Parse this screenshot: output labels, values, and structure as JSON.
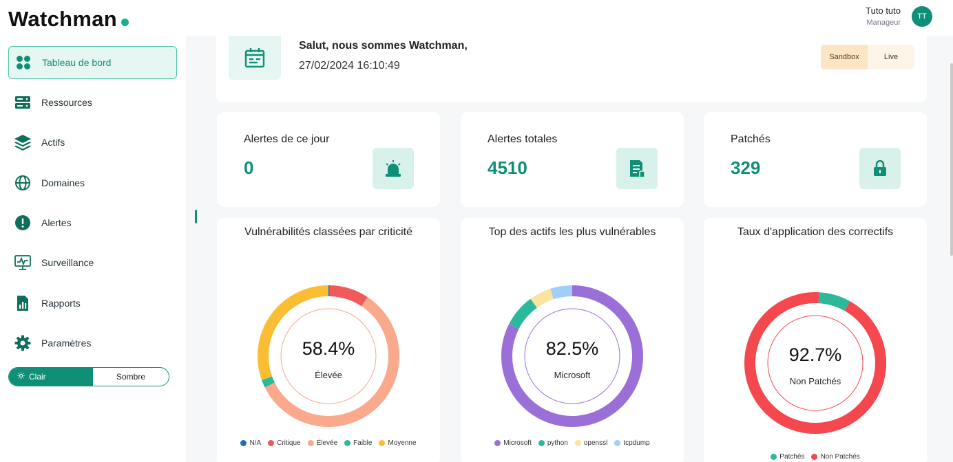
{
  "brand": {
    "name": "Watchman"
  },
  "user": {
    "name": "Tuto tuto",
    "role": "Manageur",
    "initials": "TT"
  },
  "sidebar": {
    "items": [
      {
        "label": "Tableau de bord",
        "icon": "dashboard-icon"
      },
      {
        "label": "Ressources",
        "icon": "server-icon"
      },
      {
        "label": "Actifs",
        "icon": "layers-icon"
      },
      {
        "label": "Domaines",
        "icon": "globe-icon"
      },
      {
        "label": "Alertes",
        "icon": "alert-icon"
      },
      {
        "label": "Surveillance",
        "icon": "monitor-icon"
      },
      {
        "label": "Rapports",
        "icon": "report-icon"
      },
      {
        "label": "Paramètres",
        "icon": "gear-icon"
      }
    ],
    "theme": {
      "light": "Clair",
      "dark": "Sombre",
      "selected": "Clair"
    }
  },
  "welcome": {
    "greeting": "Salut, nous sommes Watchman,",
    "datetime": "27/02/2024 16:10:49",
    "env": {
      "sandbox": "Sandbox",
      "live": "Live",
      "selected": "Sandbox"
    }
  },
  "stats": [
    {
      "title": "Alertes de ce jour",
      "value": "0",
      "icon": "siren-icon"
    },
    {
      "title": "Alertes totales",
      "value": "4510",
      "icon": "document-icon"
    },
    {
      "title": "Patchés",
      "value": "329",
      "icon": "lock-icon"
    }
  ],
  "colors": {
    "accent": "#0e8f76",
    "accentLight": "#e6f6f2"
  },
  "chart_data": [
    {
      "type": "pie",
      "title": "Vulnérabilités classées par criticité",
      "center_value": "58.4%",
      "center_label": "Élevée",
      "categories": [
        "N/A",
        "Critique",
        "Élevée",
        "Faible",
        "Moyenne"
      ],
      "values": [
        0.3,
        9.0,
        58.4,
        1.8,
        30.5
      ],
      "colors": [
        "#1f6fb8",
        "#f25a5a",
        "#fba98c",
        "#2cb89a",
        "#fbbd34"
      ],
      "legend": "bottom"
    },
    {
      "type": "pie",
      "title": "Top des actifs les plus vulnérables",
      "center_value": "82.5%",
      "center_label": "Microsoft",
      "categories": [
        "Microsoft",
        "python",
        "openssl",
        "tcpdump"
      ],
      "values": [
        82.5,
        7.5,
        5.0,
        5.0
      ],
      "colors": [
        "#9b6fd8",
        "#2cb89a",
        "#fde3a2",
        "#9fcff7"
      ],
      "legend": "bottom"
    },
    {
      "type": "pie",
      "title": "Taux d'application des correctifs",
      "center_value": "92.7%",
      "center_label": "Non Patchés",
      "categories": [
        "Patchés",
        "Non Patchés"
      ],
      "values": [
        7.3,
        92.7
      ],
      "colors": [
        "#2cb89a",
        "#f4474e"
      ],
      "legend": "bottom"
    }
  ]
}
